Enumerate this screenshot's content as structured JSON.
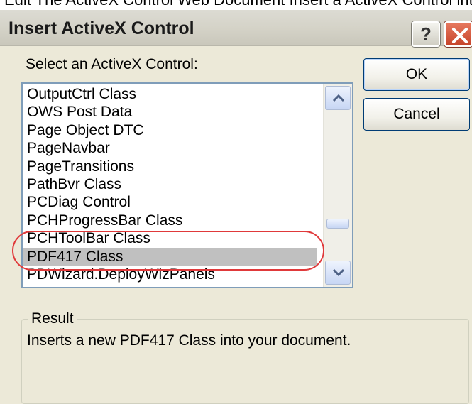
{
  "top_caption": "Edit   The      ActiveX Control                    Web Document  Insert a     ActiveX Control into the   ",
  "dialog": {
    "title": "Insert ActiveX Control",
    "help_label": "?"
  },
  "select_label": "Select an ActiveX Control:",
  "list": {
    "items": [
      "OutputCtrl Class",
      "OWS Post Data",
      "Page Object DTC",
      "PageNavbar",
      "PageTransitions",
      "PathBvr Class",
      "PCDiag Control",
      "PCHProgressBar Class",
      "PCHToolBar Class",
      "PDF417 Class",
      "PDWizard.DeployWizPanels"
    ],
    "selected": "PDF417 Class"
  },
  "buttons": {
    "ok": "OK",
    "cancel": "Cancel"
  },
  "result": {
    "legend": "Result",
    "text": "Inserts a new PDF417 Class into your document."
  },
  "colors": {
    "dialog_bg": "#ece9d8",
    "selection_bg": "#c0c0c0",
    "highlight_oval": "#e0393a",
    "close_button": "#c6442a"
  }
}
